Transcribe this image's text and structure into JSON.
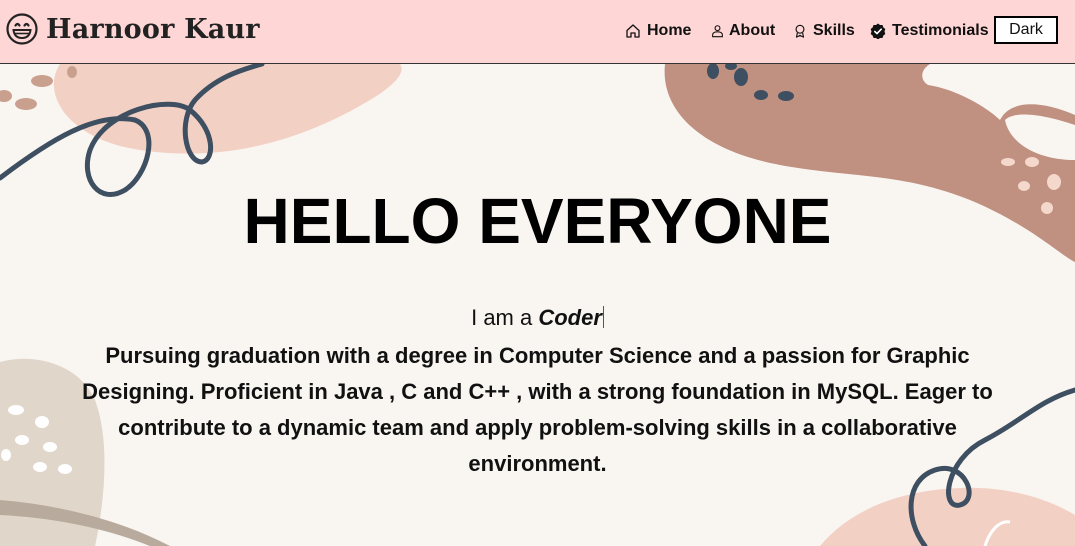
{
  "nav": {
    "brand_name": "Harnoor Kaur",
    "brand_icon": "grinning-face-icon",
    "items": [
      {
        "label": "Home",
        "icon": "home-icon"
      },
      {
        "label": "About",
        "icon": "person-icon"
      },
      {
        "label": "Skills",
        "icon": "award-icon"
      },
      {
        "label": "Testimonials",
        "icon": "verified-badge-icon"
      }
    ],
    "theme_button": "Dark"
  },
  "hero": {
    "title": "HELLO EVERYONE",
    "intro_prefix": "I am a ",
    "role": "Coder",
    "bio": "Pursuing graduation with a degree in Computer Science and a passion for Graphic Designing. Proficient in Java , C and C++ , with a strong foundation in MySQL. Eager to contribute to a dynamic team and apply problem-solving skills in a collaborative environment."
  },
  "colors": {
    "navbar_bg": "#ffd6d6",
    "page_bg": "#f9f5f1",
    "blob_brown": "#c09080",
    "blob_pink": "#f3d0c4",
    "blob_beige": "#e0d6ca",
    "squiggle": "#3d4f60"
  }
}
